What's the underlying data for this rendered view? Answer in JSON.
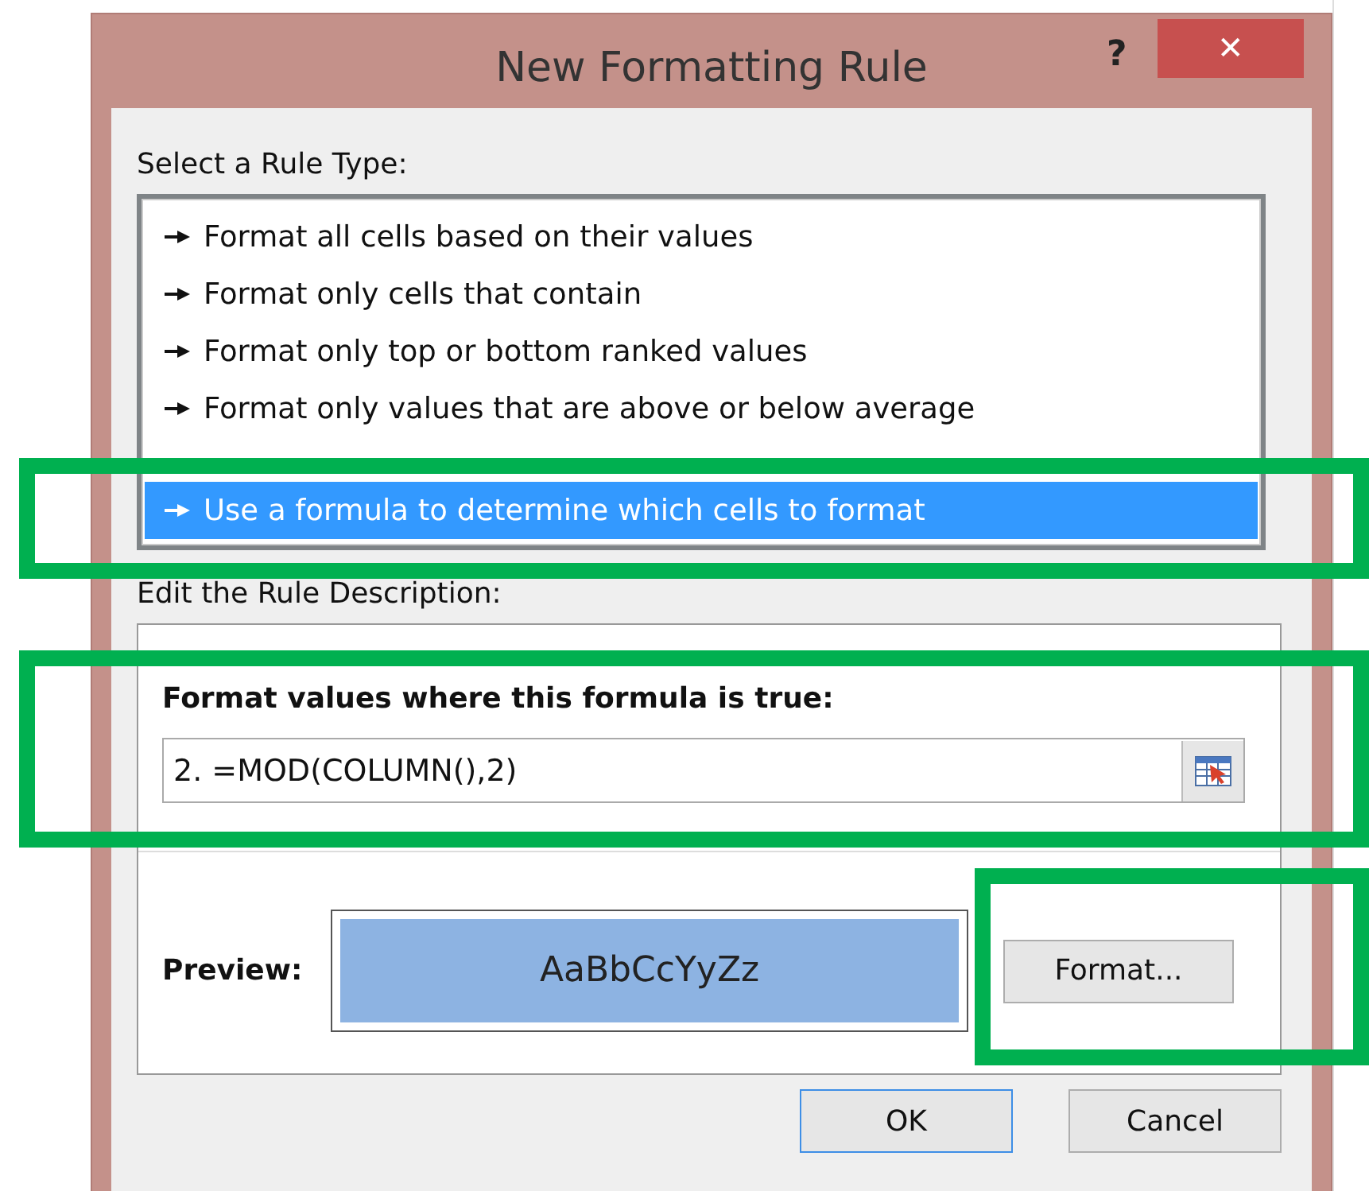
{
  "window": {
    "title": "New Formatting Rule",
    "help": "?",
    "close": "✕"
  },
  "rule_type": {
    "label": "Select a Rule Type:",
    "items": [
      {
        "label": "Format all cells based on their values",
        "selected": false
      },
      {
        "label": "Format only cells that contain",
        "selected": false
      },
      {
        "label": "Format only top or bottom ranked values",
        "selected": false
      },
      {
        "label": "Format only values that are above or below average",
        "selected": false
      },
      {
        "label": "Use a formula to determine which cells to format",
        "selected": true
      }
    ]
  },
  "description": {
    "label": "Edit the Rule Description:",
    "formula_label": "Format values where this formula is true:",
    "formula": "2. =MOD(COLUMN(),2)",
    "preview_label": "Preview:",
    "preview_text": "AaBbCcYyZz",
    "format_button": "Format..."
  },
  "buttons": [
    {
      "label": "OK",
      "default": true
    },
    {
      "label": "Cancel",
      "default": false
    }
  ]
}
